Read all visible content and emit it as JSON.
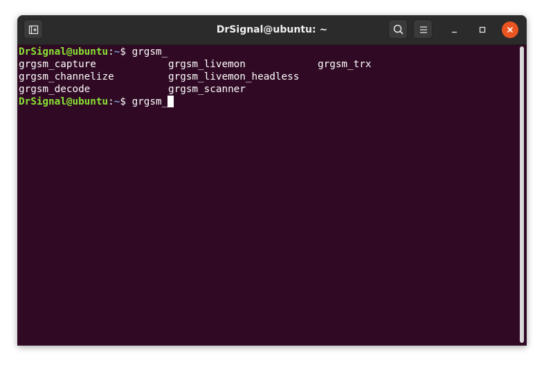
{
  "window": {
    "title": "DrSignal@ubuntu: ~"
  },
  "icons": {
    "new_tab": "new-tab-icon",
    "search": "search-icon",
    "menu": "hamburger-menu-icon",
    "minimize": "minimize-icon",
    "maximize": "maximize-icon",
    "close": "close-icon"
  },
  "colors": {
    "terminal_background": "#300a24",
    "prompt_user": "#8ae234",
    "prompt_path": "#729fcf",
    "close_button": "#e95420"
  },
  "terminal": {
    "prompt1": {
      "user_host": "DrSignal@ubuntu",
      "colon": ":",
      "path": "~",
      "symbol": "$ ",
      "command": "grgsm_"
    },
    "completions": [
      [
        "grgsm_capture",
        "grgsm_livemon",
        "grgsm_trx"
      ],
      [
        "grgsm_channelize",
        "grgsm_livemon_headless",
        ""
      ],
      [
        "grgsm_decode",
        "grgsm_scanner",
        ""
      ]
    ],
    "prompt2": {
      "user_host": "DrSignal@ubuntu",
      "colon": ":",
      "path": "~",
      "symbol": "$ ",
      "command": "grgsm_"
    }
  }
}
